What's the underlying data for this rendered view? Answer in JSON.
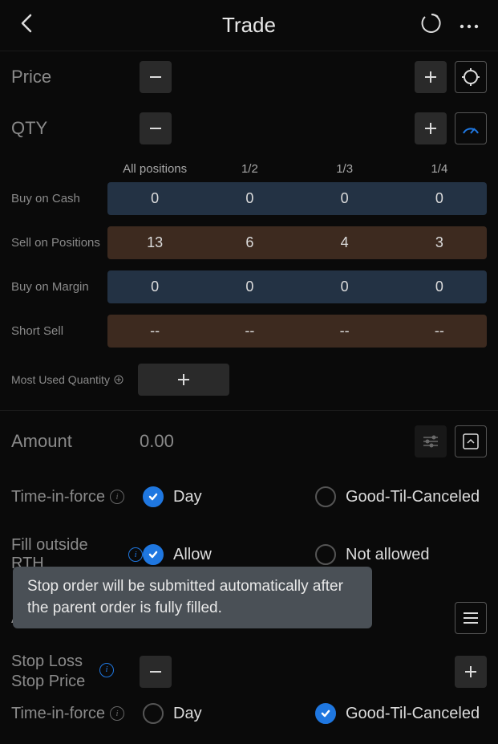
{
  "header": {
    "title": "Trade"
  },
  "price": {
    "label": "Price"
  },
  "qty": {
    "label": "QTY"
  },
  "table": {
    "headers": [
      "All positions",
      "1/2",
      "1/3",
      "1/4"
    ],
    "rows": [
      {
        "label": "Buy on Cash",
        "type": "buy",
        "values": [
          "0",
          "0",
          "0",
          "0"
        ]
      },
      {
        "label": "Sell on Positions",
        "type": "sell",
        "values": [
          "13",
          "6",
          "4",
          "3"
        ]
      },
      {
        "label": "Buy on Margin",
        "type": "buy",
        "values": [
          "0",
          "0",
          "0",
          "0"
        ]
      },
      {
        "label": "Short Sell",
        "type": "short",
        "values": [
          "--",
          "--",
          "--",
          "--"
        ]
      }
    ],
    "most_used_label": "Most Used Quantity"
  },
  "amount": {
    "label": "Amount",
    "value": "0.00"
  },
  "tif": {
    "label": "Time-in-force",
    "options": [
      "Day",
      "Good-Til-Canceled"
    ],
    "selected": 0
  },
  "fill_rth": {
    "label": "Fill outside RTH",
    "options": [
      "Allow",
      "Not allowed"
    ],
    "selected": 0
  },
  "attached": {
    "label": "Attached Order"
  },
  "stop_loss": {
    "label_line1": "Stop Loss",
    "label_line2": "Stop Price"
  },
  "tif2": {
    "label": "Time-in-force",
    "options": [
      "Day",
      "Good-Til-Canceled"
    ],
    "selected": 1
  },
  "tooltip": {
    "text": "Stop order will be submitted automatically after the parent order is fully filled."
  }
}
